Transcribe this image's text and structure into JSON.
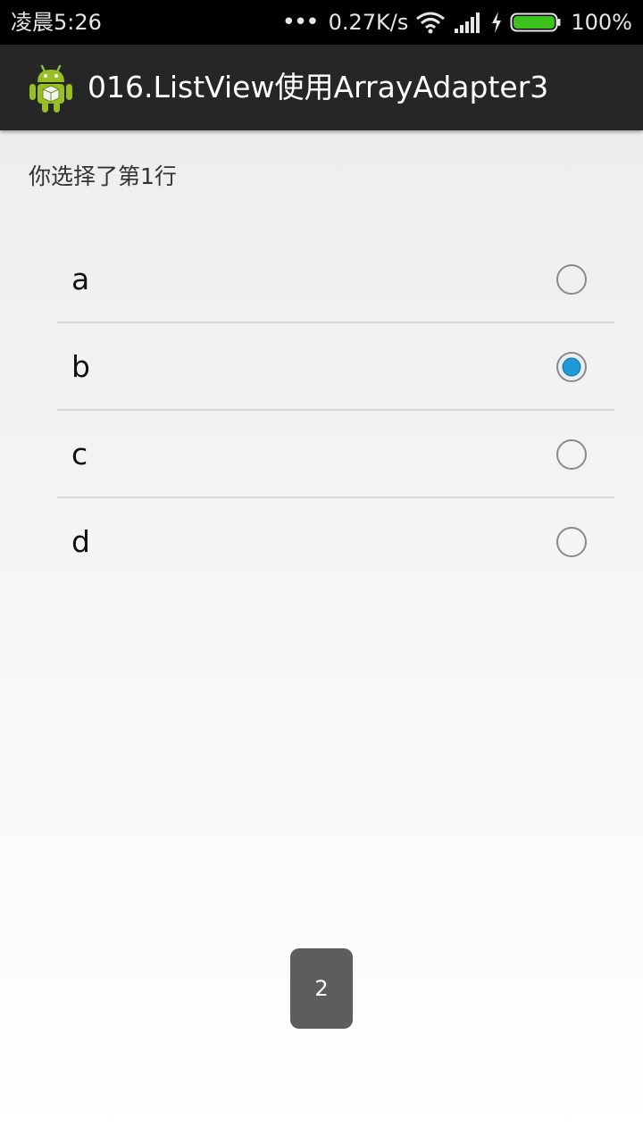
{
  "status_bar": {
    "time": "凌晨5:26",
    "network_speed": "0.27K/s",
    "battery_percent": "100%",
    "icons": [
      "more-dots-icon",
      "wifi-icon",
      "signal-icon",
      "charging-icon",
      "battery-icon"
    ],
    "battery_color": "#3cc21c"
  },
  "action_bar": {
    "title": "016.ListView使用ArrayAdapter3",
    "icon": "android-app-icon"
  },
  "content": {
    "selection_text": "你选择了第1行"
  },
  "list": {
    "items": [
      {
        "label": "a",
        "checked": false
      },
      {
        "label": "b",
        "checked": true
      },
      {
        "label": "c",
        "checked": false
      },
      {
        "label": "d",
        "checked": false
      }
    ],
    "accent_color": "#1e9ad6"
  },
  "toast": {
    "text": "2"
  }
}
